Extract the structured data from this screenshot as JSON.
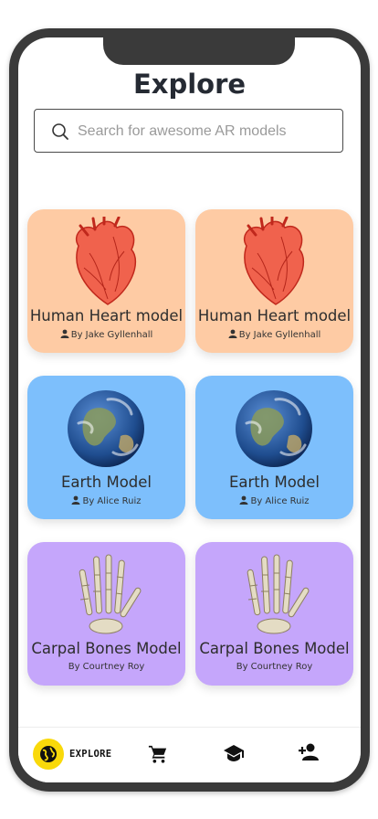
{
  "header": {
    "title": "Explore"
  },
  "search": {
    "placeholder": "Search for awesome AR models"
  },
  "cards": [
    {
      "name": "Human Heart model",
      "author": "By Jake Gyllenhall",
      "color": "#fecba4",
      "icon": "heart-image"
    },
    {
      "name": "Human Heart model",
      "author": "By Jake Gyllenhall",
      "color": "#fecba4",
      "icon": "heart-image"
    },
    {
      "name": "Earth Model",
      "author": "By Alice Ruiz",
      "color": "#7dbffc",
      "icon": "earth-image"
    },
    {
      "name": "Earth Model",
      "author": "By Alice Ruiz",
      "color": "#7dbffc",
      "icon": "earth-image"
    },
    {
      "name": "Carpal Bones Model",
      "author": "By Courtney Roy",
      "color": "#c5a6fb",
      "icon": "hand-bones-image"
    },
    {
      "name": "Carpal Bones Model",
      "author": "By Courtney Roy",
      "color": "#c5a6fb",
      "icon": "hand-bones-image"
    }
  ],
  "navbar": {
    "explore_label": "EXPLORE",
    "accent": "#f9d90a",
    "items": [
      "globe-icon",
      "cart-icon",
      "graduation-cap-icon",
      "add-person-icon"
    ]
  }
}
